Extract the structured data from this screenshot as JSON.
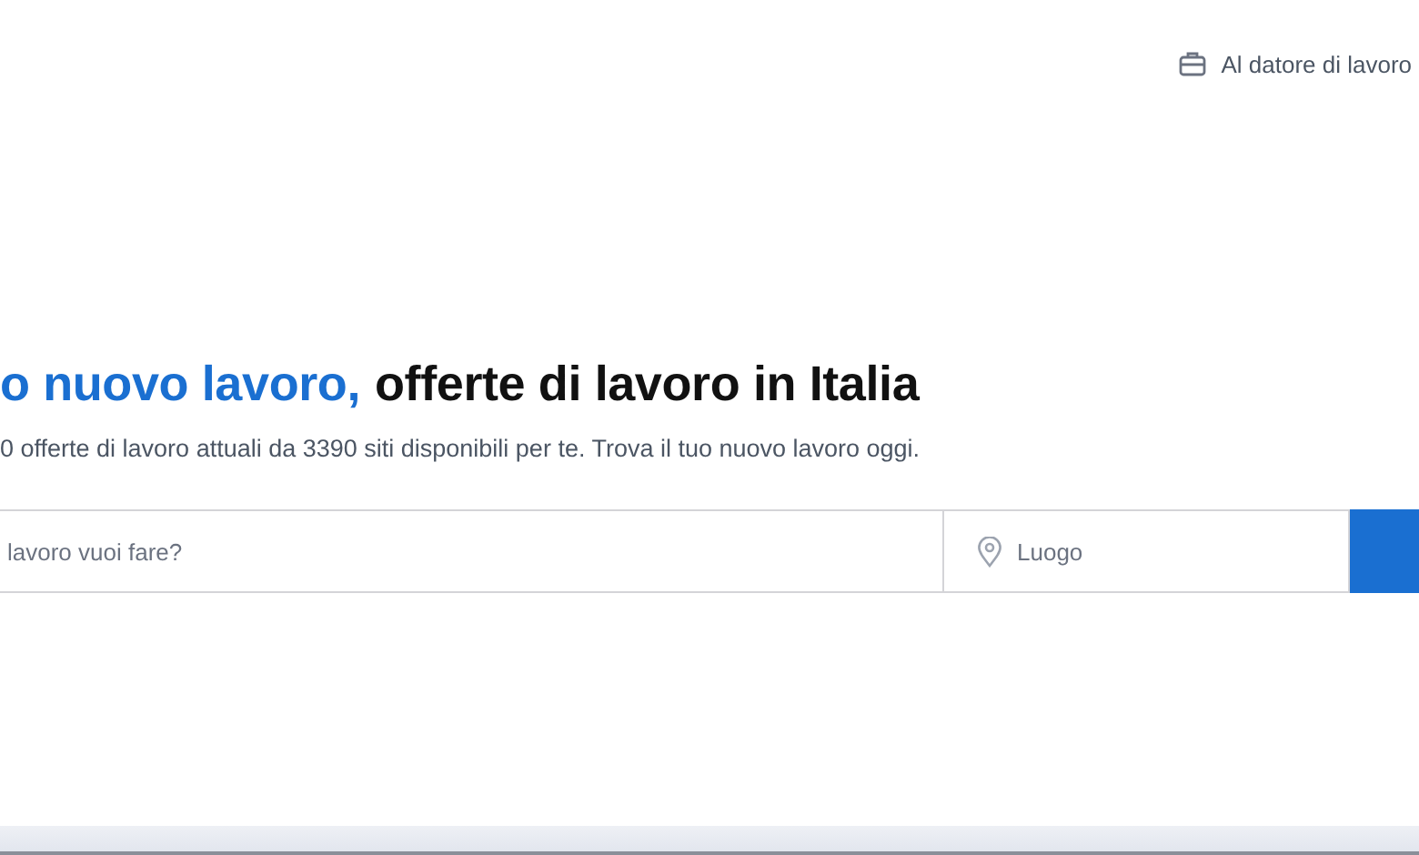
{
  "header": {
    "employer_link": "Al datore di lavoro"
  },
  "headline": {
    "highlight": "o nuovo lavoro,",
    "rest": "offerte di lavoro in Italia"
  },
  "subtitle": "0 offerte di lavoro attuali da 3390 siti disponibili per te. Trova il tuo nuovo lavoro oggi.",
  "search": {
    "job_field": {
      "placeholder": "lavoro vuoi fare?"
    },
    "location_field": {
      "placeholder": "Luogo"
    }
  }
}
